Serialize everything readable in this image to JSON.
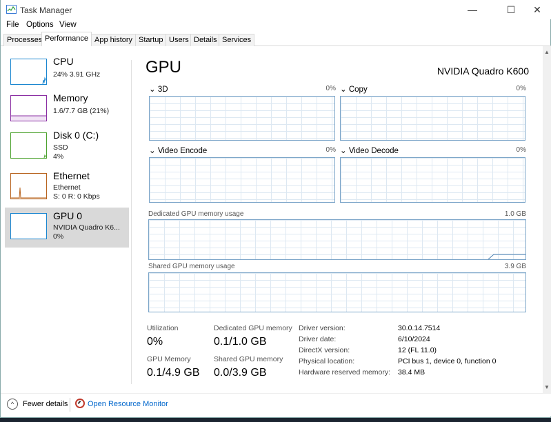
{
  "window": {
    "title": "Task Manager",
    "controls": {
      "minimize": "—",
      "maximize": "☐",
      "close": "✕"
    }
  },
  "menu": [
    "File",
    "Options",
    "View"
  ],
  "tabs": [
    "Processes",
    "Performance",
    "App history",
    "Startup",
    "Users",
    "Details",
    "Services"
  ],
  "active_tab": "Performance",
  "sidebar": [
    {
      "title": "CPU",
      "sub1": "24% 3.91 GHz",
      "sub2": "",
      "sub3": "",
      "color": "#1a86d0"
    },
    {
      "title": "Memory",
      "sub1": "1.6/7.7 GB (21%)",
      "sub2": "",
      "sub3": "",
      "color": "#8b2fa3"
    },
    {
      "title": "Disk 0 (C:)",
      "sub1": "SSD",
      "sub2": "4%",
      "sub3": "",
      "color": "#4ca22e"
    },
    {
      "title": "Ethernet",
      "sub1": "Ethernet",
      "sub2": "S: 0 R: 0 Kbps",
      "sub3": "",
      "color": "#b8641f"
    },
    {
      "title": "GPU 0",
      "sub1": "NVIDIA Quadro K6...",
      "sub2": "0%",
      "sub3": "",
      "color": "#1a86d0"
    }
  ],
  "gpu": {
    "heading": "GPU",
    "model": "NVIDIA Quadro K600",
    "engines": [
      {
        "name": "3D",
        "pct": "0%"
      },
      {
        "name": "Copy",
        "pct": "0%"
      },
      {
        "name": "Video Encode",
        "pct": "0%"
      },
      {
        "name": "Video Decode",
        "pct": "0%"
      }
    ],
    "dedicated_label": "Dedicated GPU memory usage",
    "dedicated_max": "1.0 GB",
    "shared_label": "Shared GPU memory usage",
    "shared_max": "3.9 GB",
    "stats": [
      {
        "label": "Utilization",
        "value": "0%"
      },
      {
        "label": "Dedicated GPU memory",
        "value": "0.1/1.0 GB"
      },
      {
        "label": "GPU Memory",
        "value": "0.1/4.9 GB"
      },
      {
        "label": "Shared GPU memory",
        "value": "0.0/3.9 GB"
      }
    ],
    "info": [
      {
        "label": "Driver version:",
        "value": "30.0.14.7514"
      },
      {
        "label": "Driver date:",
        "value": "6/10/2024"
      },
      {
        "label": "DirectX version:",
        "value": "12 (FL 11.0)"
      },
      {
        "label": "Physical location:",
        "value": "PCI bus 1, device 0, function 0"
      },
      {
        "label": "Hardware reserved memory:",
        "value": "38.4 MB"
      }
    ]
  },
  "footer": {
    "fewer_details": "Fewer details",
    "resource_monitor": "Open Resource Monitor"
  },
  "colors": {
    "accent": "#1a86d0",
    "selected_bg": "#d9d9d9",
    "graph_border": "#7aa4c8",
    "grid": "#dde8f2",
    "link": "#0066cc"
  }
}
